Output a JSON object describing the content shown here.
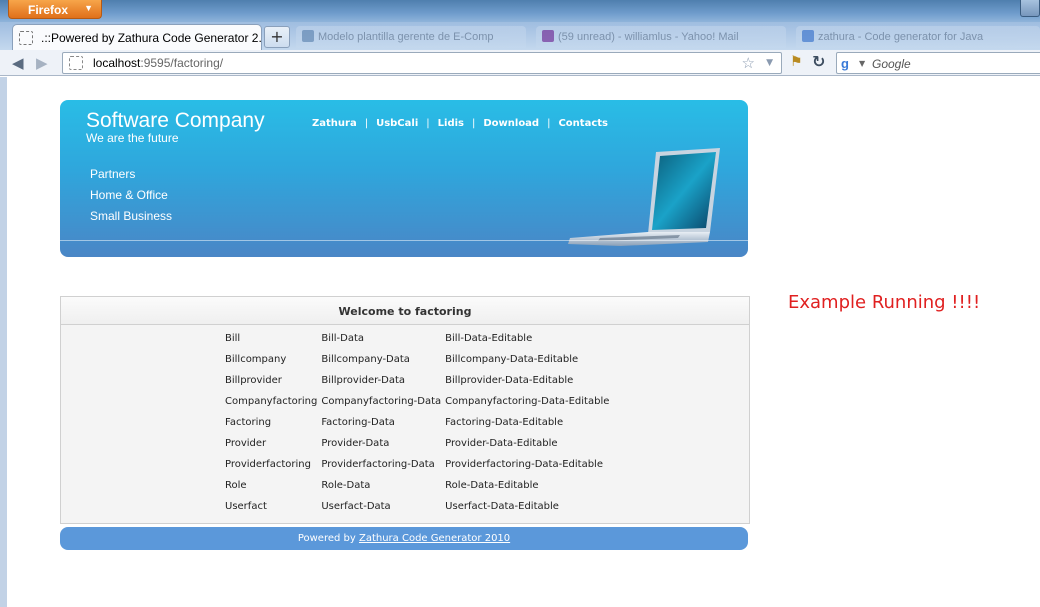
{
  "browser": {
    "menu_button": "Firefox",
    "active_tab_title": ".::Powered by Zathura Code Generator 2...",
    "background_tabs": [
      "Modelo plantilla gerente de E-Comp",
      "(59 unread) - williamlus - Yahoo! Mail",
      "zathura - Code generator for Java"
    ],
    "url_host": "localhost",
    "url_rest": ":9595/factoring/",
    "search_placeholder": "Google"
  },
  "header": {
    "brand": "Software Company",
    "slogan": "We are the future",
    "top_nav": [
      "Zathura",
      "UsbCali",
      "Lidis",
      "Download",
      "Contacts"
    ],
    "side_nav": [
      "Partners",
      "Home & Office",
      "Small Business"
    ]
  },
  "panel": {
    "title": "Welcome to factoring",
    "rows": [
      [
        "Bill",
        "Bill-Data",
        "Bill-Data-Editable"
      ],
      [
        "Billcompany",
        "Billcompany-Data",
        "Billcompany-Data-Editable"
      ],
      [
        "Billprovider",
        "Billprovider-Data",
        "Billprovider-Data-Editable"
      ],
      [
        "Companyfactoring",
        "Companyfactoring-Data",
        "Companyfactoring-Data-Editable"
      ],
      [
        "Factoring",
        "Factoring-Data",
        "Factoring-Data-Editable"
      ],
      [
        "Provider",
        "Provider-Data",
        "Provider-Data-Editable"
      ],
      [
        "Providerfactoring",
        "Providerfactoring-Data",
        "Providerfactoring-Data-Editable"
      ],
      [
        "Role",
        "Role-Data",
        "Role-Data-Editable"
      ],
      [
        "Userfact",
        "Userfact-Data",
        "Userfact-Data-Editable"
      ]
    ]
  },
  "footer": {
    "prefix": "Powered by ",
    "link": "Zathura Code Generator 2010"
  },
  "annotation": "Example Running !!!!"
}
